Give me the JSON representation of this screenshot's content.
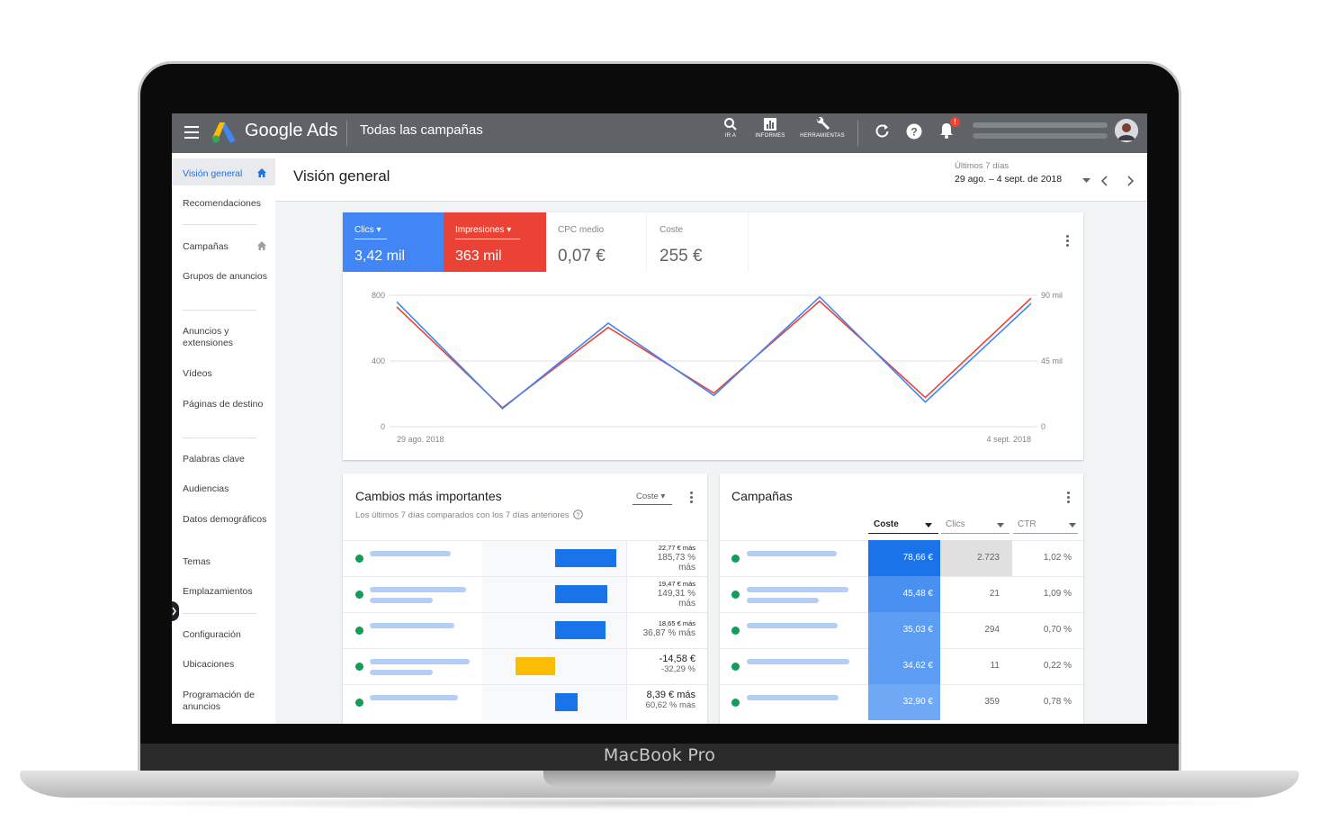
{
  "device": {
    "label": "MacBook Pro"
  },
  "topbar": {
    "app_name": "Google Ads",
    "scope": "Todas las campañas",
    "tools": [
      {
        "label": "IR A",
        "icon": "search-icon"
      },
      {
        "label": "INFORMES",
        "icon": "reports-icon"
      },
      {
        "label": "HERRAMIENTAS",
        "icon": "wrench-icon"
      }
    ],
    "notification_badge": "!"
  },
  "sidebar": {
    "items": [
      {
        "label": "Visión general",
        "active": true
      },
      {
        "label": "Recomendaciones"
      },
      {
        "label": "Campañas"
      },
      {
        "label": "Grupos de anuncios"
      },
      {
        "label": "Anuncios y extensiones"
      },
      {
        "label": "Vídeos"
      },
      {
        "label": "Páginas de destino"
      },
      {
        "label": "Palabras clave"
      },
      {
        "label": "Audiencias"
      },
      {
        "label": "Datos demográficos"
      },
      {
        "label": "Temas"
      },
      {
        "label": "Emplazamientos"
      },
      {
        "label": "Configuración"
      },
      {
        "label": "Ubicaciones"
      },
      {
        "label": "Programación de anuncios"
      }
    ]
  },
  "header": {
    "title": "Visión general",
    "date_sub": "Últimos 7 días",
    "date_range": "29 ago. – 4 sept. de 2018"
  },
  "metrics": [
    {
      "label": "Clics",
      "value": "3,42 mil",
      "color": "#4285f4"
    },
    {
      "label": "Impresiones",
      "value": "363 mil",
      "color": "#ea4335"
    },
    {
      "label": "CPC medio",
      "value": "0,07 €"
    },
    {
      "label": "Coste",
      "value": "255 €"
    }
  ],
  "chart_data": {
    "type": "line",
    "x": [
      "29 ago. 2018",
      "",
      "",
      "",
      "",
      "",
      "4 sept. 2018"
    ],
    "series": [
      {
        "name": "Clics",
        "color": "#4285f4",
        "axis": "left",
        "values": [
          760,
          110,
          630,
          190,
          790,
          150,
          750
        ]
      },
      {
        "name": "Impresiones",
        "color": "#ea4335",
        "axis": "right",
        "values": [
          82000,
          13000,
          68000,
          23000,
          86000,
          20000,
          88000
        ]
      }
    ],
    "y_left": {
      "ticks": [
        "800",
        "400",
        "0"
      ],
      "lim": [
        0,
        800
      ]
    },
    "y_right": {
      "ticks": [
        "90 mil",
        "45 mil",
        "0"
      ],
      "lim": [
        0,
        90000
      ]
    },
    "x_tick_labels": [
      "29 ago. 2018",
      "4 sept. 2018"
    ],
    "grid": true
  },
  "changes": {
    "title": "Cambios más importantes",
    "subtitle": "Los últimos 7 días comparados con los 7 días anteriores",
    "metric_select": "Coste",
    "rows": [
      {
        "value": 22.77,
        "line1": "22,77 € más",
        "line2": "185,73 %",
        "line3": "más",
        "color": "#1a73e8"
      },
      {
        "value": 19.47,
        "line1": "19,47 € más",
        "line2": "149,31 %",
        "line3": "más",
        "color": "#1a73e8"
      },
      {
        "value": 18.65,
        "line1": "18,65 € más",
        "line2": "36,87 % más",
        "line3": "",
        "color": "#1a73e8"
      },
      {
        "value": -14.58,
        "line1": "-14,58 €",
        "line2": "-32,29 %",
        "line3": "",
        "color": "#fbbc04"
      },
      {
        "value": 8.39,
        "line1": "8,39 € más",
        "line2": "60,62 % más",
        "line3": "",
        "color": "#1a73e8"
      }
    ]
  },
  "campaigns": {
    "title": "Campañas",
    "columns": [
      "Coste",
      "Clics",
      "CTR"
    ],
    "rows": [
      {
        "cost": "78,66 €",
        "clicks": "2.723",
        "ctr": "1,02 %"
      },
      {
        "cost": "45,48 €",
        "clicks": "21",
        "ctr": "1,09 %"
      },
      {
        "cost": "35,03 €",
        "clicks": "294",
        "ctr": "0,70 %"
      },
      {
        "cost": "34,62 €",
        "clicks": "11",
        "ctr": "0,22 %"
      },
      {
        "cost": "32,90 €",
        "clicks": "359",
        "ctr": "0,78 %"
      }
    ]
  }
}
